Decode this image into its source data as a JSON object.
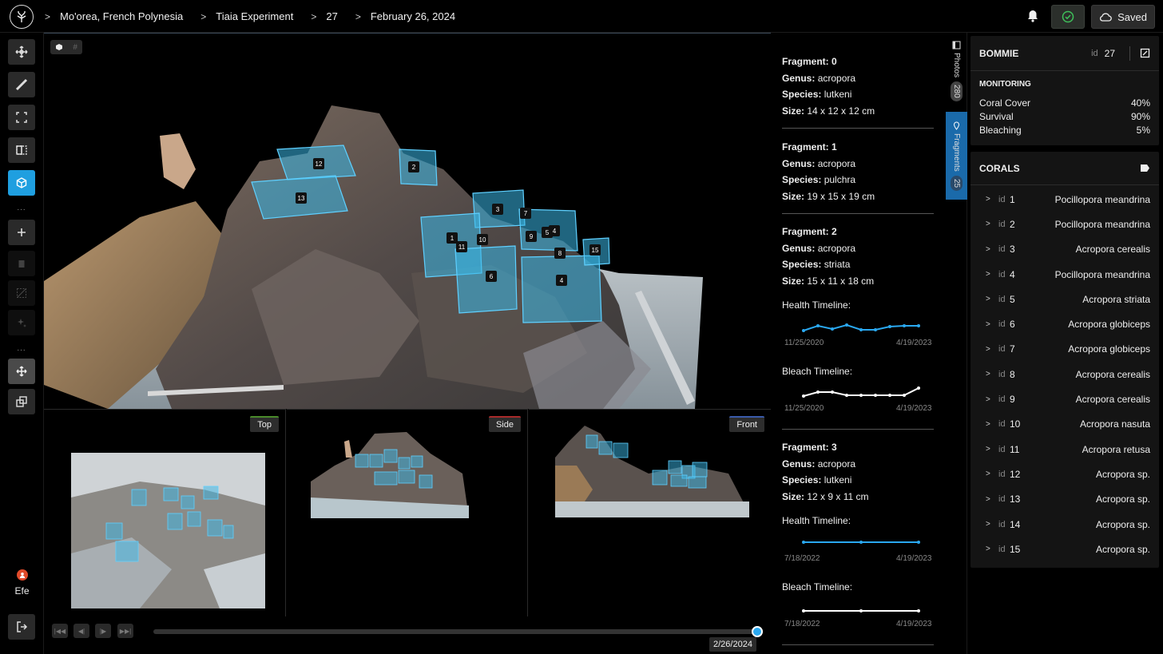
{
  "breadcrumbs": [
    "Mo'orea, French Polynesia",
    "Tiaia Experiment",
    "27",
    "February 26, 2024"
  ],
  "header": {
    "saved_label": "Saved"
  },
  "user": {
    "name": "Efe"
  },
  "views": {
    "top": "Top",
    "side": "Side",
    "front": "Front"
  },
  "timeline": {
    "current_date": "2/26/2024",
    "progress": 1.0
  },
  "box_tags": [
    "12",
    "2",
    "13",
    "3",
    "7",
    "9",
    "5",
    "4",
    "1",
    "11",
    "10",
    "8",
    "15",
    "6",
    "4"
  ],
  "fragments": [
    {
      "title": "Fragment: 0",
      "genus_label": "Genus:",
      "genus": "acropora",
      "species_label": "Species:",
      "species": "lutkeni",
      "size_label": "Size:",
      "size": "14 x 12 x 12 cm"
    },
    {
      "title": "Fragment: 1",
      "genus_label": "Genus:",
      "genus": "acropora",
      "species_label": "Species:",
      "species": "pulchra",
      "size_label": "Size:",
      "size": "19 x 15 x 19 cm"
    },
    {
      "title": "Fragment: 2",
      "genus_label": "Genus:",
      "genus": "acropora",
      "species_label": "Species:",
      "species": "striata",
      "size_label": "Size:",
      "size": "15 x 11 x 18 cm",
      "health_label": "Health Timeline:",
      "health_start": "11/25/2020",
      "health_end": "4/19/2023",
      "bleach_label": "Bleach Timeline:",
      "bleach_start": "11/25/2020",
      "bleach_end": "4/19/2023"
    },
    {
      "title": "Fragment: 3",
      "genus_label": "Genus:",
      "genus": "acropora",
      "species_label": "Species:",
      "species": "lutkeni",
      "size_label": "Size:",
      "size": "12 x 9 x 11 cm",
      "health_label": "Health Timeline:",
      "health_start": "7/18/2022",
      "health_end": "4/19/2023",
      "bleach_label": "Bleach Timeline:",
      "bleach_start": "7/18/2022",
      "bleach_end": "4/19/2023"
    }
  ],
  "side_tabs": {
    "photos_label": "Photos",
    "photos_count": "280",
    "fragments_label": "Fragments",
    "fragments_count": "25"
  },
  "bommie": {
    "title": "BOMMIE",
    "id_label": "id",
    "id": "27"
  },
  "monitoring": {
    "title": "MONITORING",
    "rows": [
      {
        "label": "Coral Cover",
        "value": "40%"
      },
      {
        "label": "Survival",
        "value": "90%"
      },
      {
        "label": "Bleaching",
        "value": "5%"
      }
    ]
  },
  "corals": {
    "title": "CORALS",
    "id_label": "id",
    "items": [
      {
        "id": "1",
        "name": "Pocillopora meandrina"
      },
      {
        "id": "2",
        "name": "Pocillopora meandrina"
      },
      {
        "id": "3",
        "name": "Acropora cerealis"
      },
      {
        "id": "4",
        "name": "Pocillopora meandrina"
      },
      {
        "id": "5",
        "name": "Acropora striata"
      },
      {
        "id": "6",
        "name": "Acropora globiceps"
      },
      {
        "id": "7",
        "name": "Acropora globiceps"
      },
      {
        "id": "8",
        "name": "Acropora cerealis"
      },
      {
        "id": "9",
        "name": "Acropora cerealis"
      },
      {
        "id": "10",
        "name": "Acropora nasuta"
      },
      {
        "id": "11",
        "name": "Acropora retusa"
      },
      {
        "id": "12",
        "name": "Acropora sp."
      },
      {
        "id": "13",
        "name": "Acropora sp."
      },
      {
        "id": "14",
        "name": "Acropora sp."
      },
      {
        "id": "15",
        "name": "Acropora sp."
      }
    ]
  },
  "colors": {
    "accent": "#1f9fe0",
    "health_line": "#2aa8f0",
    "bleach_line": "#ffffff",
    "box_fill": "#3ab8e8"
  }
}
